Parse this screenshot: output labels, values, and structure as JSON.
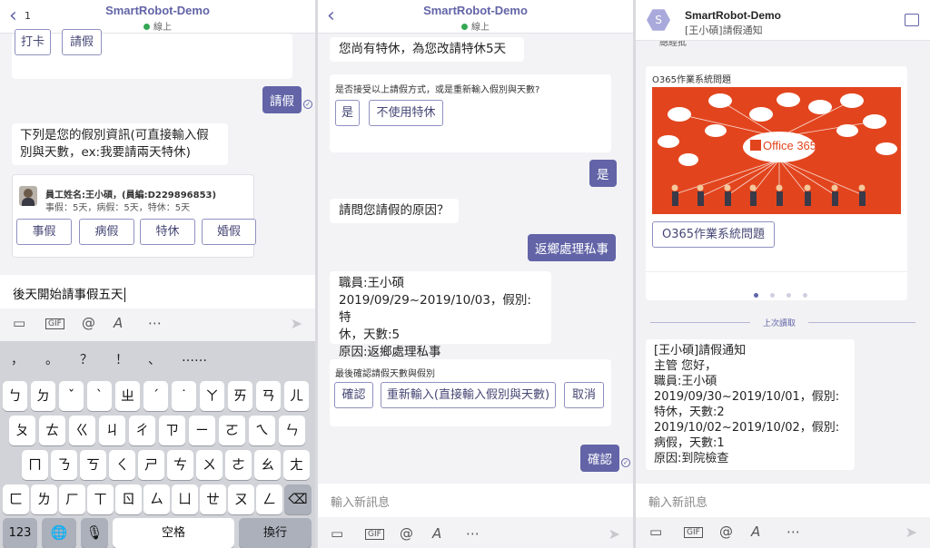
{
  "panel1": {
    "header": {
      "back_count": "1",
      "title": "SmartRobot-Demo",
      "status": "線上"
    },
    "top_buttons": [
      "打卡",
      "請假"
    ],
    "user_msg": "請假",
    "bot_msg": "下列是您的假別資訊(可直接輸入假別與天數，ex:我要請兩天特休)",
    "card": {
      "employee": "員工姓名:王小碩，(員編:D229896853)",
      "quota": "事假：5天，病假：5天，特休：5天",
      "buttons": [
        "事假",
        "病假",
        "特休",
        "婚假"
      ]
    },
    "input_value": "後天開始請事假五天",
    "keyboard": {
      "punct": [
        "，",
        "。",
        "？",
        "！",
        "、",
        "……"
      ],
      "row1": [
        "ㄅ",
        "ㄉ",
        "ˇ",
        "ˋ",
        "ㄓ",
        "ˊ",
        "˙",
        "ㄚ",
        "ㄞ",
        "ㄢ",
        "ㄦ"
      ],
      "row2": [
        "ㄆ",
        "ㄊ",
        "ㄍ",
        "ㄐ",
        "ㄔ",
        "ㄗ",
        "ㄧ",
        "ㄛ",
        "ㄟ",
        "ㄣ"
      ],
      "row3": [
        "ㄇ",
        "ㄋ",
        "ㄎ",
        "ㄑ",
        "ㄕ",
        "ㄘ",
        "ㄨ",
        "ㄜ",
        "ㄠ",
        "ㄤ"
      ],
      "row4": [
        "ㄈ",
        "ㄌ",
        "ㄏ",
        "ㄒ",
        "ㄖ",
        "ㄙ",
        "ㄩ",
        "ㄝ",
        "ㄡ",
        "ㄥ"
      ],
      "num_key": "123",
      "space_key": "空格",
      "return_key": "換行"
    }
  },
  "panel2": {
    "header": {
      "title": "SmartRobot-Demo",
      "status": "線上"
    },
    "bot_msg1": "您尚有特休，為您改請特休5天",
    "card1": {
      "question": "是否接受以上請假方式，或是重新輸入假別與天數?",
      "buttons": [
        "是",
        "不使用特休"
      ]
    },
    "user_msg1": "是",
    "bot_msg2": "請問您請假的原因？",
    "user_msg2": "返鄉處理私事",
    "summary": [
      "職員:王小碩",
      "2019/09/29~2019/10/03，假別:特",
      "休，天數:5",
      "原因:返鄉處理私事"
    ],
    "card2": {
      "title": "最後確認請假天數與假別",
      "buttons": [
        "確認",
        "重新輸入(直接輸入假別與天數)",
        "取消"
      ]
    },
    "user_msg3": "確認",
    "input_placeholder": "輸入新訊息"
  },
  "panel3": {
    "header": {
      "avatar": "S",
      "title": "SmartRobot-Demo",
      "subtitle": "[王小碩]請假通知"
    },
    "cut_text": "總經批",
    "card": {
      "title": "O365作業系統問題",
      "image_label": "Office 365",
      "button": "O365作業系統問題"
    },
    "divider_label": "上次讀取",
    "notice": [
      "[王小碩]請假通知",
      "主管 您好，",
      "職員:王小碩",
      "2019/09/30~2019/10/01，假別:",
      "特休，天數:2",
      "2019/10/02~2019/10/02，假別:",
      "病假，天數:1",
      "原因:到院檢查"
    ],
    "input_placeholder": "輸入新訊息"
  },
  "colors": {
    "accent": "#6264a7",
    "office_orange": "#e2451e",
    "online": "#34a853"
  }
}
